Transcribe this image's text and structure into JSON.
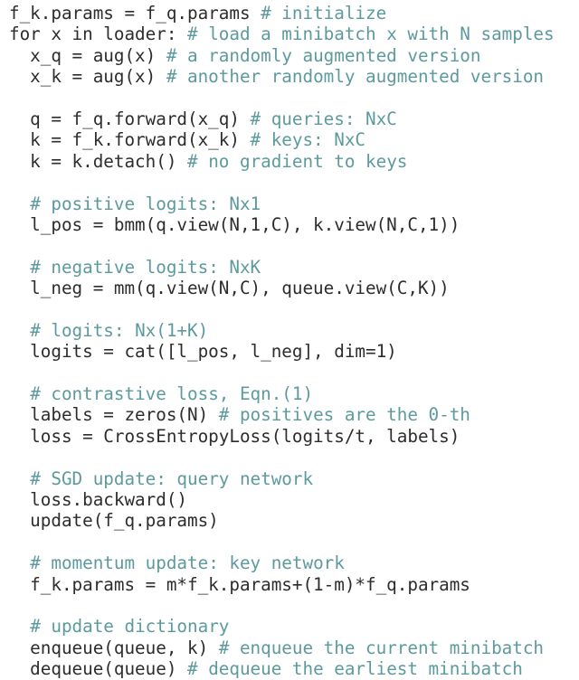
{
  "document": {
    "kind": "code-listing",
    "language": "python-pseudocode",
    "background_color": "#ffffff",
    "code_color": "#2d2d2d",
    "comment_color": "#5d9a9e"
  },
  "code": {
    "lines": [
      {
        "index": 1,
        "text": "f_k.params = f_q.params # initialize",
        "tokens": [
          {
            "type": "code",
            "text": "f_k.params = f_q.params "
          },
          {
            "type": "comment",
            "text": "# initialize"
          }
        ]
      },
      {
        "index": 2,
        "text": "for x in loader: # load a minibatch x with N samples",
        "tokens": [
          {
            "type": "code",
            "text": "for x in loader: "
          },
          {
            "type": "comment",
            "text": "# load a minibatch x with N samples"
          }
        ]
      },
      {
        "index": 3,
        "text": "  x_q = aug(x) # a randomly augmented version",
        "tokens": [
          {
            "type": "code",
            "text": "  x_q = aug(x) "
          },
          {
            "type": "comment",
            "text": "# a randomly augmented version"
          }
        ]
      },
      {
        "index": 4,
        "text": "  x_k = aug(x) # another randomly augmented version",
        "tokens": [
          {
            "type": "code",
            "text": "  x_k = aug(x) "
          },
          {
            "type": "comment",
            "text": "# another randomly augmented version"
          }
        ]
      },
      {
        "index": 5,
        "text": "",
        "tokens": []
      },
      {
        "index": 6,
        "text": "  q = f_q.forward(x_q) # queries: NxC",
        "tokens": [
          {
            "type": "code",
            "text": "  q = f_q.forward(x_q) "
          },
          {
            "type": "comment",
            "text": "# queries: NxC"
          }
        ]
      },
      {
        "index": 7,
        "text": "  k = f_k.forward(x_k) # keys: NxC",
        "tokens": [
          {
            "type": "code",
            "text": "  k = f_k.forward(x_k) "
          },
          {
            "type": "comment",
            "text": "# keys: NxC"
          }
        ]
      },
      {
        "index": 8,
        "text": "  k = k.detach() # no gradient to keys",
        "tokens": [
          {
            "type": "code",
            "text": "  k = k.detach() "
          },
          {
            "type": "comment",
            "text": "# no gradient to keys"
          }
        ]
      },
      {
        "index": 9,
        "text": "",
        "tokens": []
      },
      {
        "index": 10,
        "text": "  # positive logits: Nx1",
        "tokens": [
          {
            "type": "code",
            "text": "  "
          },
          {
            "type": "comment",
            "text": "# positive logits: Nx1"
          }
        ]
      },
      {
        "index": 11,
        "text": "  l_pos = bmm(q.view(N,1,C), k.view(N,C,1))",
        "tokens": [
          {
            "type": "code",
            "text": "  l_pos = bmm(q.view(N,1,C), k.view(N,C,1))"
          }
        ]
      },
      {
        "index": 12,
        "text": "",
        "tokens": []
      },
      {
        "index": 13,
        "text": "  # negative logits: NxK",
        "tokens": [
          {
            "type": "code",
            "text": "  "
          },
          {
            "type": "comment",
            "text": "# negative logits: NxK"
          }
        ]
      },
      {
        "index": 14,
        "text": "  l_neg = mm(q.view(N,C), queue.view(C,K))",
        "tokens": [
          {
            "type": "code",
            "text": "  l_neg = mm(q.view(N,C), queue.view(C,K))"
          }
        ]
      },
      {
        "index": 15,
        "text": "",
        "tokens": []
      },
      {
        "index": 16,
        "text": "  # logits: Nx(1+K)",
        "tokens": [
          {
            "type": "code",
            "text": "  "
          },
          {
            "type": "comment",
            "text": "# logits: Nx(1+K)"
          }
        ]
      },
      {
        "index": 17,
        "text": "  logits = cat([l_pos, l_neg], dim=1)",
        "tokens": [
          {
            "type": "code",
            "text": "  logits = cat([l_pos, l_neg], dim=1)"
          }
        ]
      },
      {
        "index": 18,
        "text": "",
        "tokens": []
      },
      {
        "index": 19,
        "text": "  # contrastive loss, Eqn.(1)",
        "tokens": [
          {
            "type": "code",
            "text": "  "
          },
          {
            "type": "comment",
            "text": "# contrastive loss, Eqn.(1)"
          }
        ]
      },
      {
        "index": 20,
        "text": "  labels = zeros(N) # positives are the 0-th",
        "tokens": [
          {
            "type": "code",
            "text": "  labels = zeros(N) "
          },
          {
            "type": "comment",
            "text": "# positives are the 0-th"
          }
        ]
      },
      {
        "index": 21,
        "text": "  loss = CrossEntropyLoss(logits/t, labels)",
        "tokens": [
          {
            "type": "code",
            "text": "  loss = CrossEntropyLoss(logits/t, labels)"
          }
        ]
      },
      {
        "index": 22,
        "text": "",
        "tokens": []
      },
      {
        "index": 23,
        "text": "  # SGD update: query network",
        "tokens": [
          {
            "type": "code",
            "text": "  "
          },
          {
            "type": "comment",
            "text": "# SGD update: query network"
          }
        ]
      },
      {
        "index": 24,
        "text": "  loss.backward()",
        "tokens": [
          {
            "type": "code",
            "text": "  loss.backward()"
          }
        ]
      },
      {
        "index": 25,
        "text": "  update(f_q.params)",
        "tokens": [
          {
            "type": "code",
            "text": "  update(f_q.params)"
          }
        ]
      },
      {
        "index": 26,
        "text": "",
        "tokens": []
      },
      {
        "index": 27,
        "text": "  # momentum update: key network",
        "tokens": [
          {
            "type": "code",
            "text": "  "
          },
          {
            "type": "comment",
            "text": "# momentum update: key network"
          }
        ]
      },
      {
        "index": 28,
        "text": "  f_k.params = m*f_k.params+(1-m)*f_q.params",
        "tokens": [
          {
            "type": "code",
            "text": "  f_k.params = m*f_k.params+(1-m)*f_q.params"
          }
        ]
      },
      {
        "index": 29,
        "text": "",
        "tokens": []
      },
      {
        "index": 30,
        "text": "  # update dictionary",
        "tokens": [
          {
            "type": "code",
            "text": "  "
          },
          {
            "type": "comment",
            "text": "# update dictionary"
          }
        ]
      },
      {
        "index": 31,
        "text": "  enqueue(queue, k) # enqueue the current minibatch",
        "tokens": [
          {
            "type": "code",
            "text": "  enqueue(queue, k) "
          },
          {
            "type": "comment",
            "text": "# enqueue the current minibatch"
          }
        ]
      },
      {
        "index": 32,
        "text": "  dequeue(queue) # dequeue the earliest minibatch",
        "tokens": [
          {
            "type": "code",
            "text": "  dequeue(queue) "
          },
          {
            "type": "comment",
            "text": "# dequeue the earliest minibatch"
          }
        ]
      }
    ]
  }
}
